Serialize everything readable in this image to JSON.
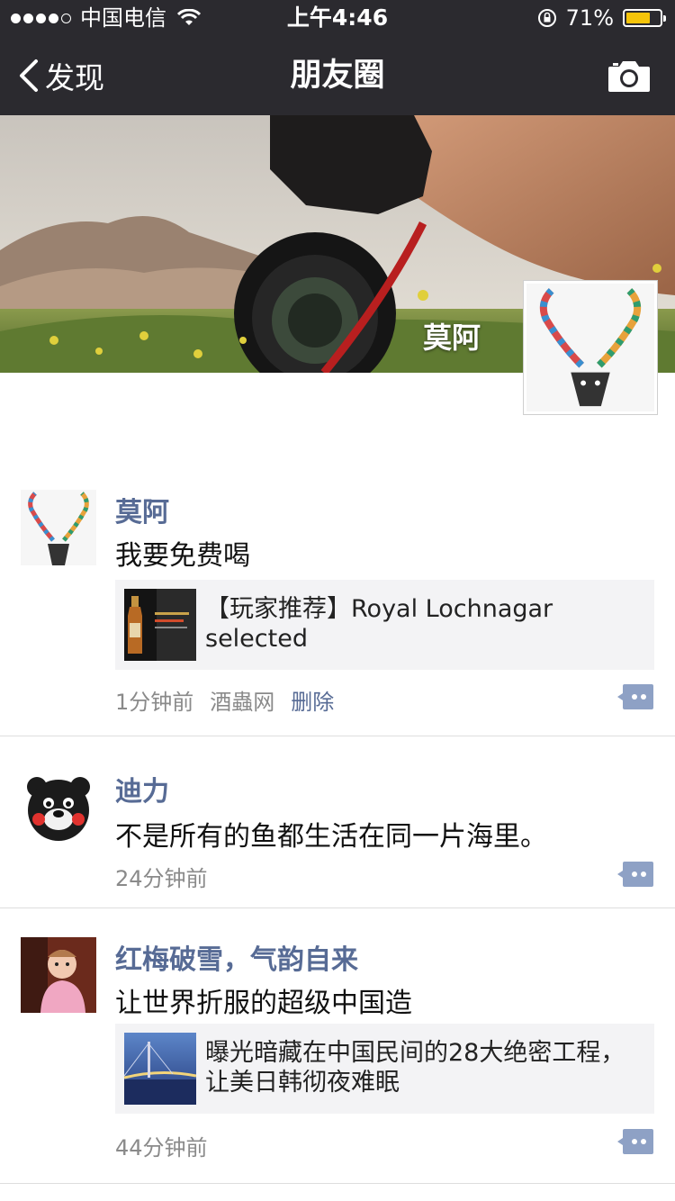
{
  "status_bar": {
    "carrier": "中国电信",
    "time": "上午4:46",
    "battery_percent": "71%",
    "battery_level": 0.71,
    "battery_color": "#f5c40a"
  },
  "nav": {
    "back_label": "发现",
    "title": "朋友圈",
    "camera_icon": "camera-icon"
  },
  "profile": {
    "name": "莫阿"
  },
  "posts": [
    {
      "name": "莫阿",
      "text": "我要免费喝",
      "link": {
        "text": "【玩家推荐】Royal Lochnagar selected"
      },
      "time": "1分钟前",
      "source": "酒蟲网",
      "delete_label": "删除"
    },
    {
      "name": "迪力",
      "text": "不是所有的鱼都生活在同一片海里。",
      "time": "24分钟前"
    },
    {
      "name": "红梅破雪，气韵自来",
      "text": "让世界折服的超级中国造",
      "link": {
        "text": "曝光暗藏在中国民间的28大绝密工程，让美日韩彻夜难眠"
      },
      "time": "44分钟前"
    }
  ],
  "colors": {
    "nav_bg": "#2b2a2f",
    "name_link": "#576b95",
    "link_card_bg": "#f3f3f5",
    "meta_gray": "#8a8a8a"
  }
}
